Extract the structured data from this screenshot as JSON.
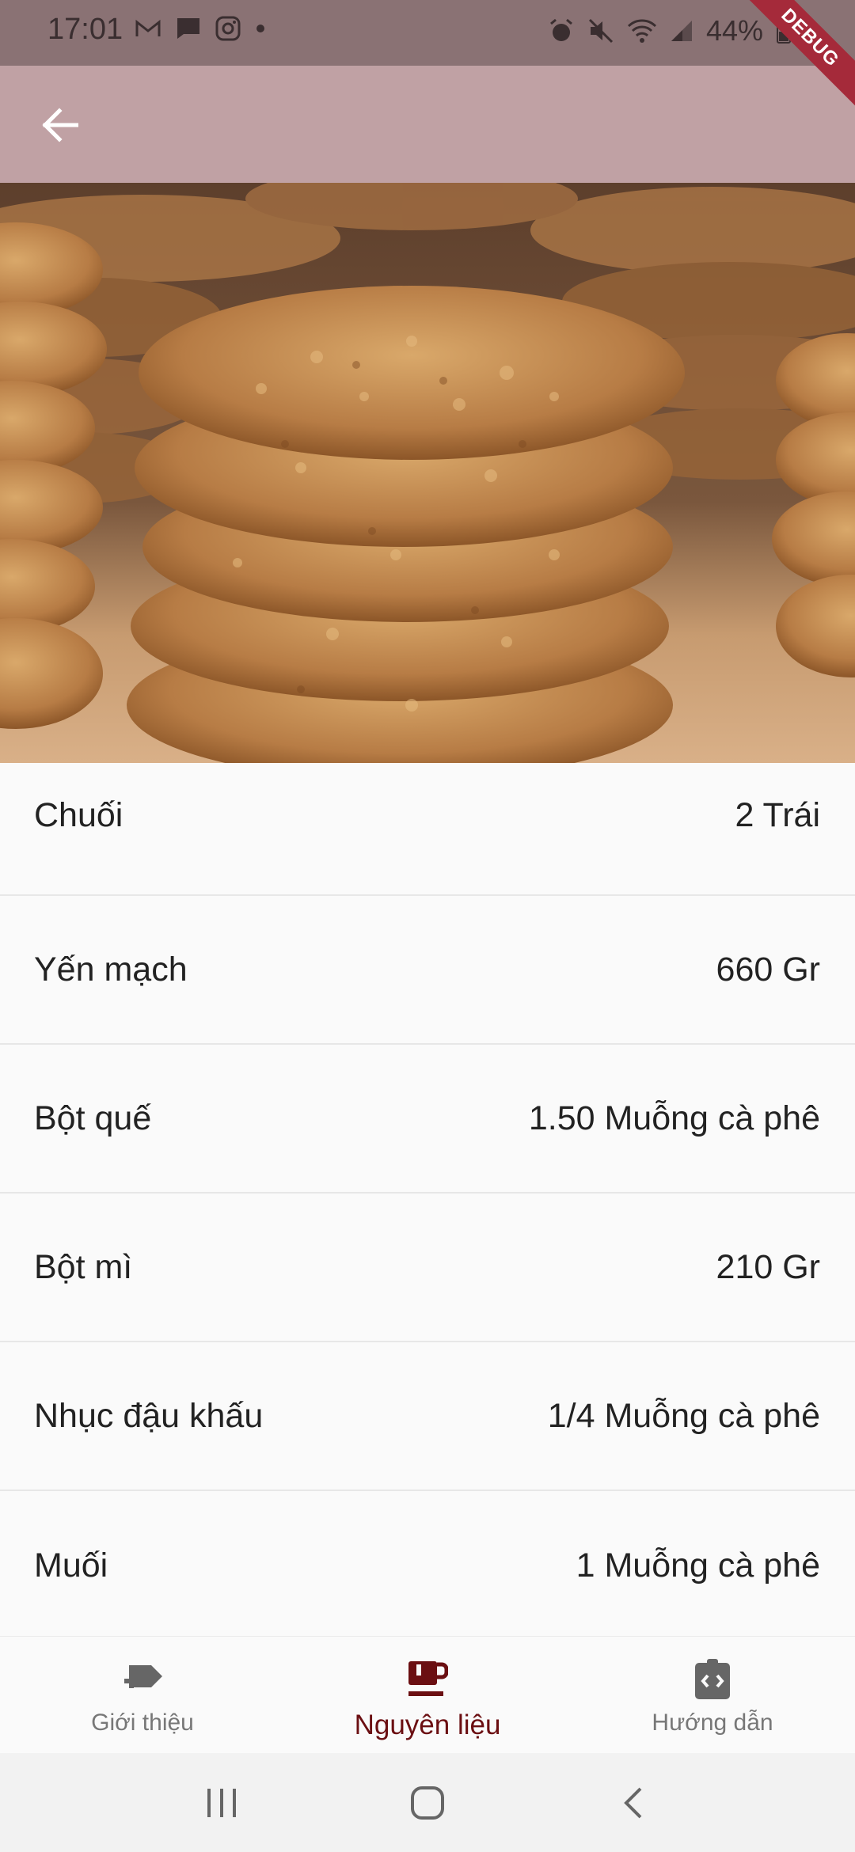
{
  "status_bar": {
    "time": "17:01",
    "battery": "44%",
    "left_icons": [
      "gmail-icon",
      "chat-icon",
      "instagram-icon",
      "dot-icon"
    ],
    "right_icons": [
      "alarm-icon",
      "mute-icon",
      "wifi-icon",
      "signal-icon",
      "battery-icon"
    ],
    "debug_label": "DEBUG"
  },
  "app_bar": {
    "back_icon": "arrow-back-icon",
    "color": "#c0a1a4"
  },
  "hero_image": {
    "subject": "stack of oatmeal cookies"
  },
  "ingredients": [
    {
      "name": "Chuối",
      "amount": "2 Trái"
    },
    {
      "name": "Yến mạch",
      "amount": "660 Gr"
    },
    {
      "name": "Bột quế",
      "amount": "1.50 Muỗng cà phê"
    },
    {
      "name": "Bột mì",
      "amount": "210 Gr"
    },
    {
      "name": "Nhục đậu khấu",
      "amount": "1/4 Muỗng cà phê"
    },
    {
      "name": "Muối",
      "amount": "1 Muỗng cà phê"
    }
  ],
  "bottom_nav": {
    "tabs": [
      {
        "label": "Giới thiệu",
        "icon": "add-tag-icon",
        "active": false
      },
      {
        "label": "Nguyên liệu",
        "icon": "coffee-cup-icon",
        "active": true
      },
      {
        "label": "Hướng dẫn",
        "icon": "code-clipboard-icon",
        "active": false
      }
    ],
    "active_color": "#6b0f12",
    "inactive_color": "#777777"
  },
  "system_nav": {
    "buttons": [
      "recent-apps-icon",
      "home-icon",
      "back-icon"
    ]
  }
}
